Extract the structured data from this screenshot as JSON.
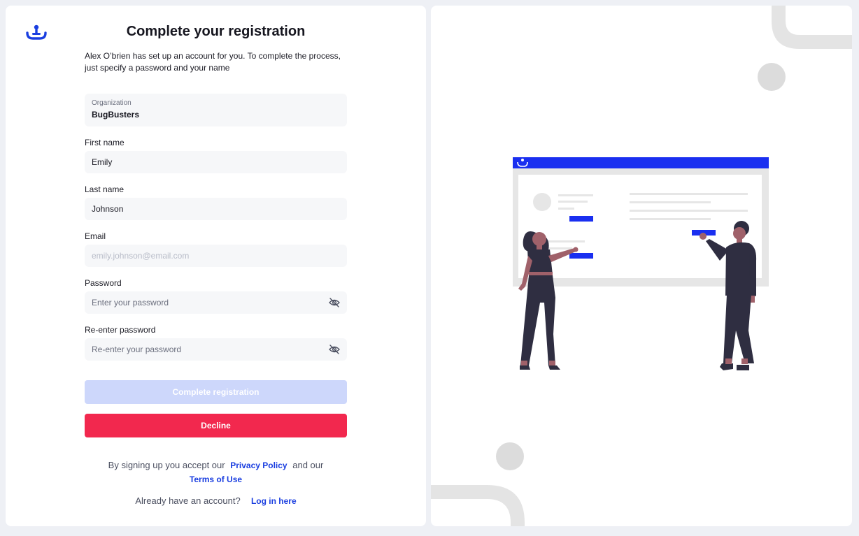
{
  "header": {
    "logo": "brand-logo-icon",
    "title": "Complete your registration",
    "subtitle": "Alex O’brien has set up an account for you. To complete the process, just specify a password and your name"
  },
  "form": {
    "organization": {
      "label": "Organization",
      "value": "BugBusters"
    },
    "first_name": {
      "label": "First name",
      "value": "Emily"
    },
    "last_name": {
      "label": "Last name",
      "value": "Johnson"
    },
    "email": {
      "label": "Email",
      "value": "",
      "placeholder": "emily.johnson@email.com"
    },
    "password": {
      "label": "Password",
      "value": "",
      "placeholder": "Enter your password",
      "icon": "eye-off-icon"
    },
    "reenter_password": {
      "label": "Re-enter password",
      "value": "",
      "placeholder": "Re-enter your password",
      "icon": "eye-off-icon"
    }
  },
  "actions": {
    "complete_label": "Complete registration",
    "decline_label": "Decline"
  },
  "footer": {
    "terms_prefix": "By signing up you accept our",
    "privacy_link": "Privacy Policy",
    "terms_middle": "and our",
    "terms_link": "Terms of Use",
    "login_prompt": "Already have an account?",
    "login_link": "Log in here"
  },
  "colors": {
    "accent": "#1a3ee0",
    "decline": "#f2284e",
    "complete_disabled": "#cdd7fb",
    "background": "#eef0f5"
  }
}
